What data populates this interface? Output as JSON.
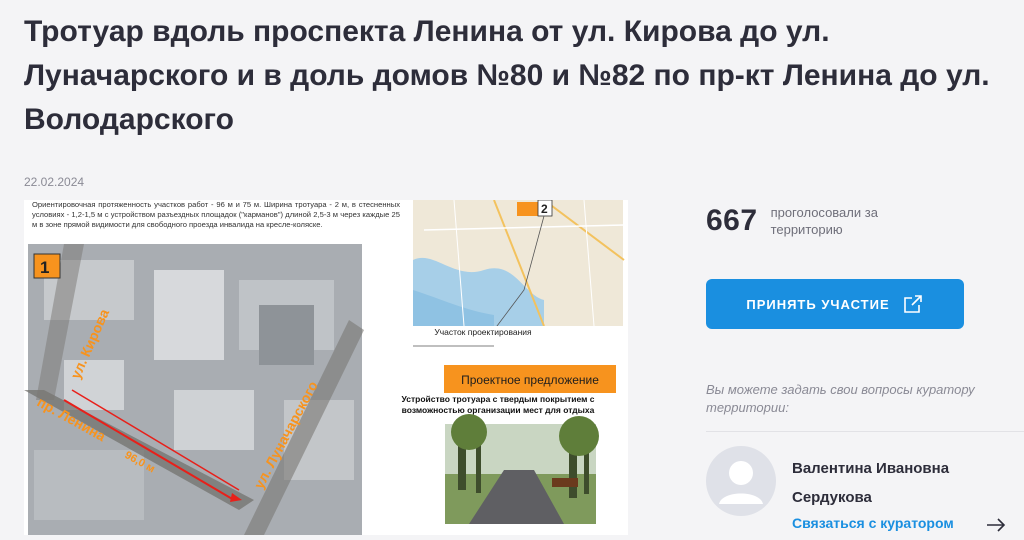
{
  "page": {
    "title": "Тротуар вдоль проспекта Ленина от ул. Кирова до ул. Луначарского и в доль домов №80 и №82 по пр-кт Ленина до ул. Володарского",
    "date": "22.02.2024"
  },
  "image": {
    "description_text": "Ориентировочная протяженность участков работ - 96 м и 75 м. Ширина тротуара - 2 м, в стесненных условиях - 1,2-1,5 м с устройством разъездных площадок (\"карманов\") длиной 2,5-3 м через каждые 25 м в зоне прямой видимости для свободного проезда инвалида на кресле-коляске.",
    "marker_1": "1",
    "marker_2": "2",
    "street_kirova": "ул. Кирова",
    "street_lenina": "пр. Ленина",
    "street_lunacharskogo": "ул. Луначарского",
    "measure": "96,0 м",
    "map_label": "Участок проектирования",
    "proposal_heading": "Проектное предложение",
    "proposal_text": "Устройство тротуара с твердым покрытием с возможностью организации мест для отдыха"
  },
  "stats": {
    "count": "667",
    "label": "проголосовали за территорию"
  },
  "actions": {
    "participate_label": "ПРИНЯТЬ УЧАСТИЕ"
  },
  "curator": {
    "note": "Вы можете задать свои вопросы куратору территории:",
    "name": "Валентина Ивановна Сердукова",
    "contact_label": "Связаться с куратором"
  },
  "colors": {
    "accent": "#1a8fe0",
    "orange": "#f7931e",
    "background": "#f4f4f6"
  },
  "icons": {
    "external_link": "external-link-icon",
    "arrow_right": "arrow-right-icon",
    "avatar": "user-avatar-icon"
  }
}
